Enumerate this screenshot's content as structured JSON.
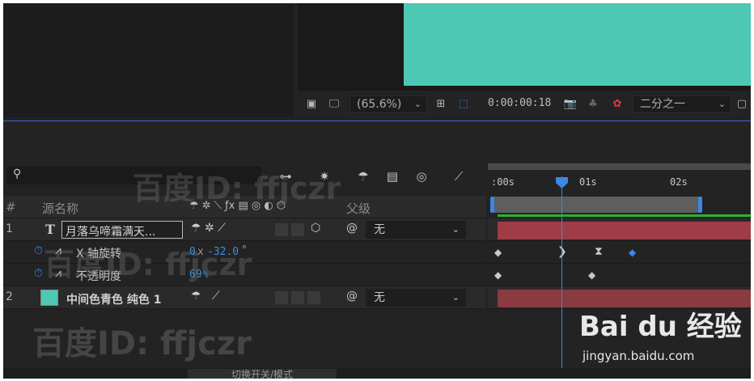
{
  "viewer": {
    "zoom": "(65.6%)",
    "timecode": "0:00:00:18",
    "resolution": "二分之一",
    "canvas_color": "#4cc8b4"
  },
  "timeline": {
    "search_placeholder": "",
    "ruler_ticks": [
      ":00s",
      "01s",
      "02s"
    ],
    "columns": {
      "hash": "#",
      "source_name": "源名称",
      "parent": "父级"
    },
    "layers": [
      {
        "num": "1",
        "type_glyph": "T",
        "name": "月落乌啼霜满天...",
        "parent": "无"
      },
      {
        "num": "2",
        "name": "中间色青色 纯色 1",
        "parent": "无",
        "swatch_color": "#4cc8b4"
      }
    ],
    "properties": [
      {
        "name": "X 轴旋转",
        "value_prefix": "0",
        "value_mid": "x",
        "value": "-32.0",
        "value_unit": "°"
      },
      {
        "name": "不透明度",
        "value": "69",
        "value_unit": "%"
      }
    ],
    "toggle_label": "切换开关/模式",
    "playhead_color": "#3d86e6"
  },
  "watermarks": {
    "text1": "百度ID: ffjczr",
    "text2": "百度ID: ffjczr",
    "text3": "百度ID: ffjczr",
    "logo": "Bai du 经验",
    "url": "jingyan.baidu.com"
  }
}
